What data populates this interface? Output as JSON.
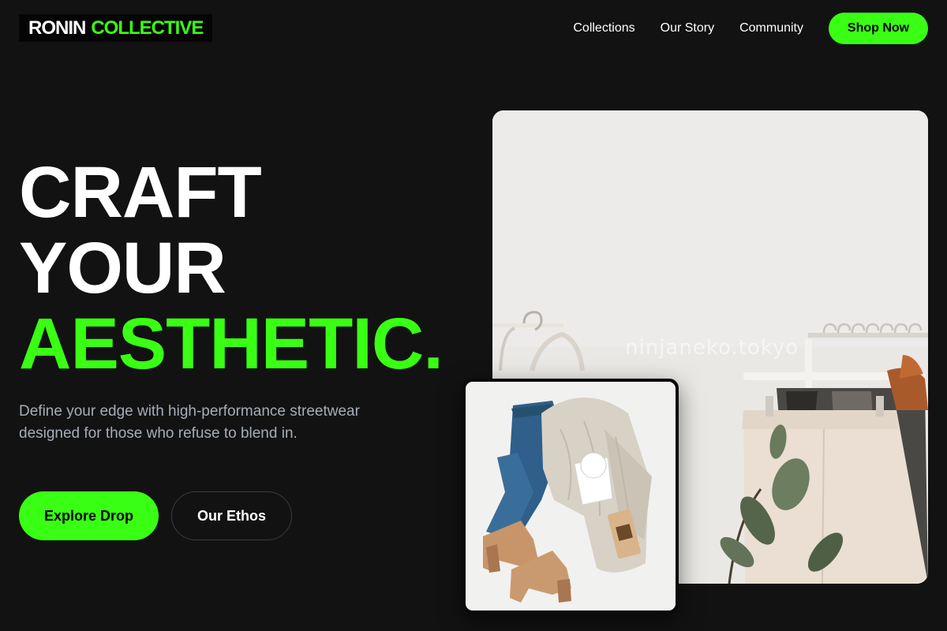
{
  "brand": {
    "word1": "RONIN",
    "word2": "COLLECTIVE"
  },
  "nav": {
    "items": [
      "Collections",
      "Our Story",
      "Community"
    ],
    "cta": "Shop Now"
  },
  "hero": {
    "headline": [
      "CRAFT",
      "YOUR",
      "AESTHETIC."
    ],
    "lead": "Define your edge with high-performance streetwear designed for those who refuse to blend in.",
    "primary_button": "Explore Drop",
    "secondary_button": "Our Ethos"
  },
  "images": {
    "main_watermark": "ninjaneko.tokyo",
    "main_subject": "clothing rack with hangers and a potted plant",
    "card_subject": "flat-lay of jeans, knit sweater, mug and ankle boots"
  },
  "colors": {
    "background": "#121212",
    "accent": "#39ff14",
    "text": "#ffffff",
    "muted": "#a6adb8"
  }
}
